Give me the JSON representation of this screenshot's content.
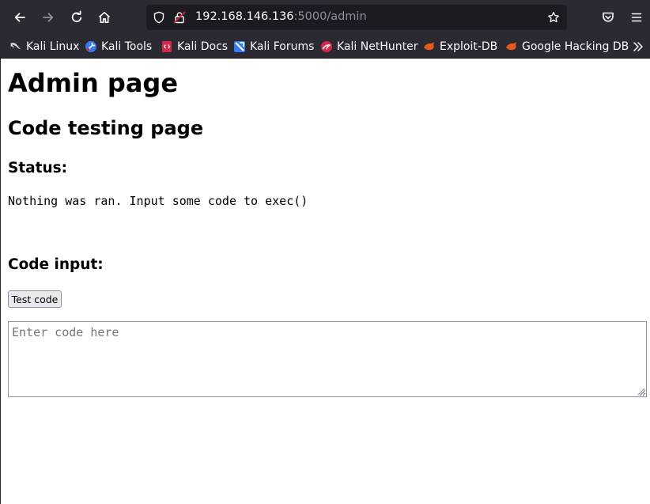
{
  "browser": {
    "url_host": "192.168.146.136",
    "url_rest": ":5000/admin",
    "bookmarks": [
      {
        "label": "Kali Linux",
        "icon": "kali-dragon-icon"
      },
      {
        "label": "Kali Tools",
        "icon": "kali-tools-icon"
      },
      {
        "label": "Kali Docs",
        "icon": "kali-docs-icon"
      },
      {
        "label": "Kali Forums",
        "icon": "kali-forums-icon"
      },
      {
        "label": "Kali NetHunter",
        "icon": "nethunter-icon"
      },
      {
        "label": "Exploit-DB",
        "icon": "exploit-db-icon"
      },
      {
        "label": "Google Hacking DB",
        "icon": "ghdb-icon"
      }
    ]
  },
  "page": {
    "title": "Admin page",
    "subtitle": "Code testing page",
    "status_heading": "Status:",
    "status_text": "Nothing was ran. Input some code to exec()",
    "code_heading": "Code input:",
    "test_button": "Test code",
    "code_placeholder": "Enter code here"
  },
  "colors": {
    "chrome_bg": "#2b2a33",
    "urlbar_bg": "#1c1b22",
    "chrome_text": "#fbfbfe",
    "accent_red": "#d7264a",
    "bookmark_orange": "#e8591a"
  }
}
